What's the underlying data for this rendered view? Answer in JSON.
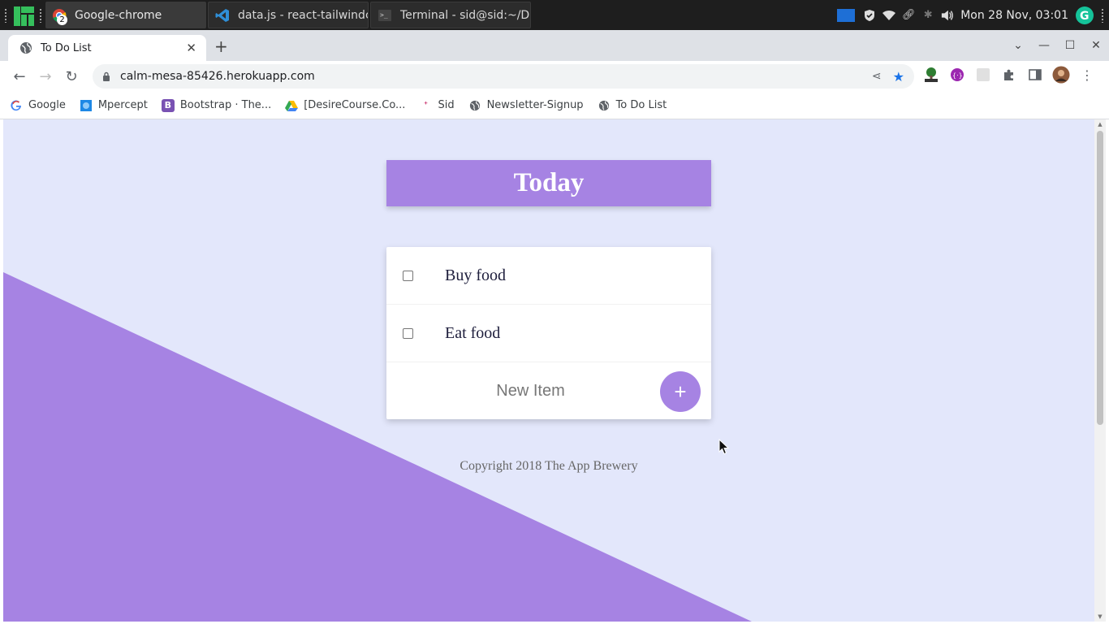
{
  "taskbar": {
    "tasks": [
      {
        "label": "Google-chrome",
        "badge": "2"
      },
      {
        "label": "data.js - react-tailwindcss-..."
      },
      {
        "label": "Terminal - sid@sid:~/Desk..."
      }
    ],
    "datetime": "Mon 28 Nov, 03:01"
  },
  "browser": {
    "tab_title": "To Do List",
    "url": "calm-mesa-85426.herokuapp.com",
    "bookmarks": [
      {
        "label": "Google",
        "icon": "google-icon"
      },
      {
        "label": "Mpercept",
        "icon": "mpercept-icon"
      },
      {
        "label": "Bootstrap · The...",
        "icon": "bootstrap-icon"
      },
      {
        "label": "[DesireCourse.Co...",
        "icon": "drive-icon"
      },
      {
        "label": "Sid",
        "icon": "sparkle-icon"
      },
      {
        "label": "Newsletter-Signup",
        "icon": "globe-icon"
      },
      {
        "label": "To Do List",
        "icon": "globe-icon"
      }
    ]
  },
  "page": {
    "heading": "Today",
    "items": [
      {
        "text": "Buy food",
        "checked": false
      },
      {
        "text": "Eat food",
        "checked": false
      }
    ],
    "new_item_placeholder": "New Item",
    "add_button_label": "+",
    "footer": "Copyright 2018 The App Brewery"
  },
  "colors": {
    "accent": "#a683e3",
    "page_background": "#e3e7fb"
  }
}
